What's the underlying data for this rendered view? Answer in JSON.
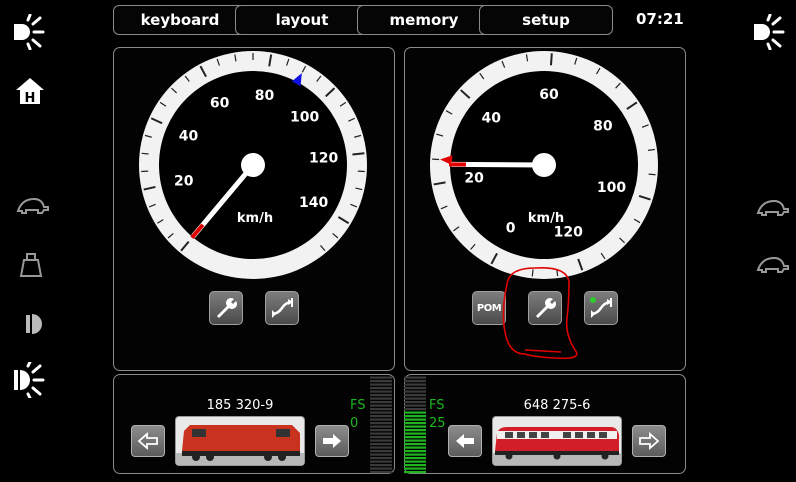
{
  "top_bar": {
    "buttons": [
      "keyboard",
      "layout",
      "memory",
      "setup"
    ],
    "time": "07:21"
  },
  "left_sidebar": {
    "icons": [
      "headlight-icon",
      "home-icon",
      "turtle-icon",
      "weight-icon",
      "dim-light-icon",
      "headlight-icon"
    ]
  },
  "right_sidebar": {
    "icons": [
      "headlight-icon",
      "turtle-icon",
      "turtle-icon"
    ]
  },
  "left_cab": {
    "speedometer": {
      "unit": "km/h",
      "labels": [
        "20",
        "40",
        "60",
        "80",
        "100",
        "120",
        "140"
      ],
      "speed_kmh": 0,
      "target_marker_kmh": 90
    },
    "loco_name": "185 320-9",
    "fs_label": "FS",
    "fs_value": "0",
    "loco_color": "#c8321e"
  },
  "right_cab": {
    "speedometer": {
      "unit": "km/h",
      "labels": [
        "0",
        "20",
        "40",
        "60",
        "80",
        "100",
        "120"
      ],
      "speed_kmh": 24,
      "target_marker_kmh": 25
    },
    "pom_label": "POM",
    "loco_name": "648 275-6",
    "fs_label": "FS",
    "fs_value": "25",
    "loco_color": "#d21e28"
  },
  "colors": {
    "accent_green": "#1fb51f",
    "needle_red": "#e00000",
    "marker_blue": "#1010e0",
    "annotation_red": "#e00000"
  }
}
